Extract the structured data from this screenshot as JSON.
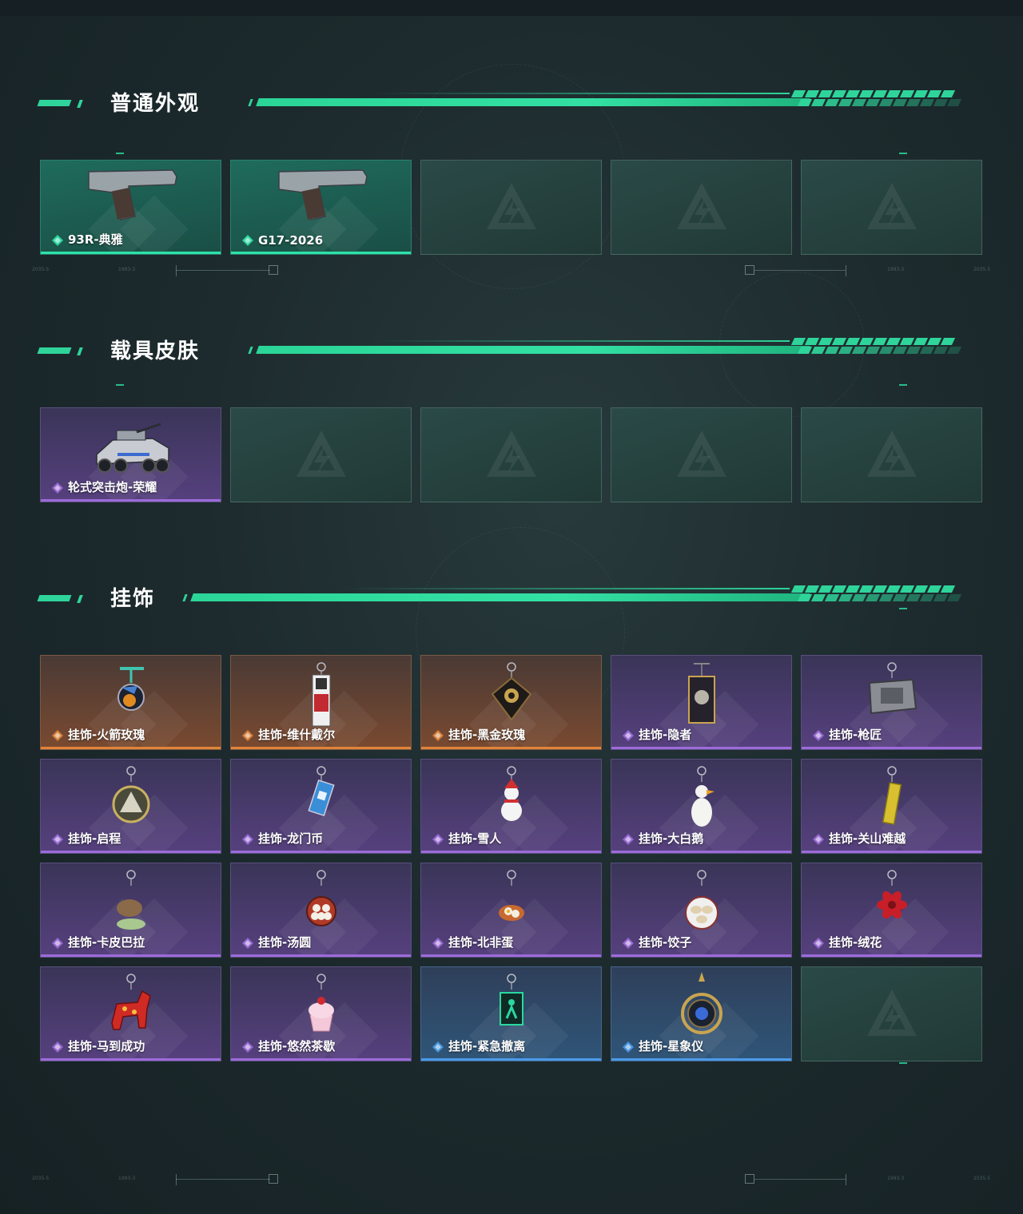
{
  "sections": [
    {
      "title": "普通外观",
      "items": [
        {
          "label": "93R-典雅",
          "rarity": "green",
          "icon": "pistol-icon"
        },
        {
          "label": "G17-2026",
          "rarity": "green",
          "icon": "pistol-icon"
        },
        null,
        null,
        null
      ]
    },
    {
      "title": "载具皮肤",
      "items": [
        {
          "label": "轮式突击炮-荣耀",
          "rarity": "purple",
          "icon": "armored-vehicle-icon"
        },
        null,
        null,
        null,
        null
      ]
    },
    {
      "title": "挂饰",
      "items": [
        {
          "label": "挂饰-火箭玫瑰",
          "rarity": "orange",
          "icon": "rocket-charm-icon"
        },
        {
          "label": "挂饰-维什戴尔",
          "rarity": "orange",
          "icon": "card-charm-icon"
        },
        {
          "label": "挂饰-黑金玫瑰",
          "rarity": "orange",
          "icon": "rose-emblem-charm-icon"
        },
        {
          "label": "挂饰-隐者",
          "rarity": "purple",
          "icon": "tarot-card-charm-icon"
        },
        {
          "label": "挂饰-枪匠",
          "rarity": "purple",
          "icon": "badge-charm-icon"
        },
        {
          "label": "挂饰-启程",
          "rarity": "purple",
          "icon": "medal-charm-icon"
        },
        {
          "label": "挂饰-龙门币",
          "rarity": "purple",
          "icon": "coin-card-charm-icon"
        },
        {
          "label": "挂饰-雪人",
          "rarity": "purple",
          "icon": "snowman-charm-icon"
        },
        {
          "label": "挂饰-大白鹅",
          "rarity": "purple",
          "icon": "goose-charm-icon"
        },
        {
          "label": "挂饰-关山难越",
          "rarity": "purple",
          "icon": "gold-bar-charm-icon"
        },
        {
          "label": "挂饰-卡皮巴拉",
          "rarity": "purple",
          "icon": "capybara-charm-icon"
        },
        {
          "label": "挂饰-汤圆",
          "rarity": "purple",
          "icon": "rice-ball-bowl-charm-icon"
        },
        {
          "label": "挂饰-北非蛋",
          "rarity": "purple",
          "icon": "egg-dish-charm-icon"
        },
        {
          "label": "挂饰-饺子",
          "rarity": "purple",
          "icon": "dumpling-plate-charm-icon"
        },
        {
          "label": "挂饰-绒花",
          "rarity": "purple",
          "icon": "red-flower-charm-icon"
        },
        {
          "label": "挂饰-马到成功",
          "rarity": "purple",
          "icon": "red-horse-charm-icon"
        },
        {
          "label": "挂饰-悠然茶歇",
          "rarity": "purple",
          "icon": "cupcake-charm-icon"
        },
        {
          "label": "挂饰-紧急撤离",
          "rarity": "blue",
          "icon": "exit-sign-charm-icon"
        },
        {
          "label": "挂饰-星象仪",
          "rarity": "blue",
          "icon": "astrolabe-charm-icon"
        },
        null
      ]
    }
  ],
  "colors": {
    "accent": "#2fd49a",
    "green": "#2ee2a8",
    "purple": "#9c6bd9",
    "orange": "#e0843a",
    "blue": "#4a9ae8"
  }
}
